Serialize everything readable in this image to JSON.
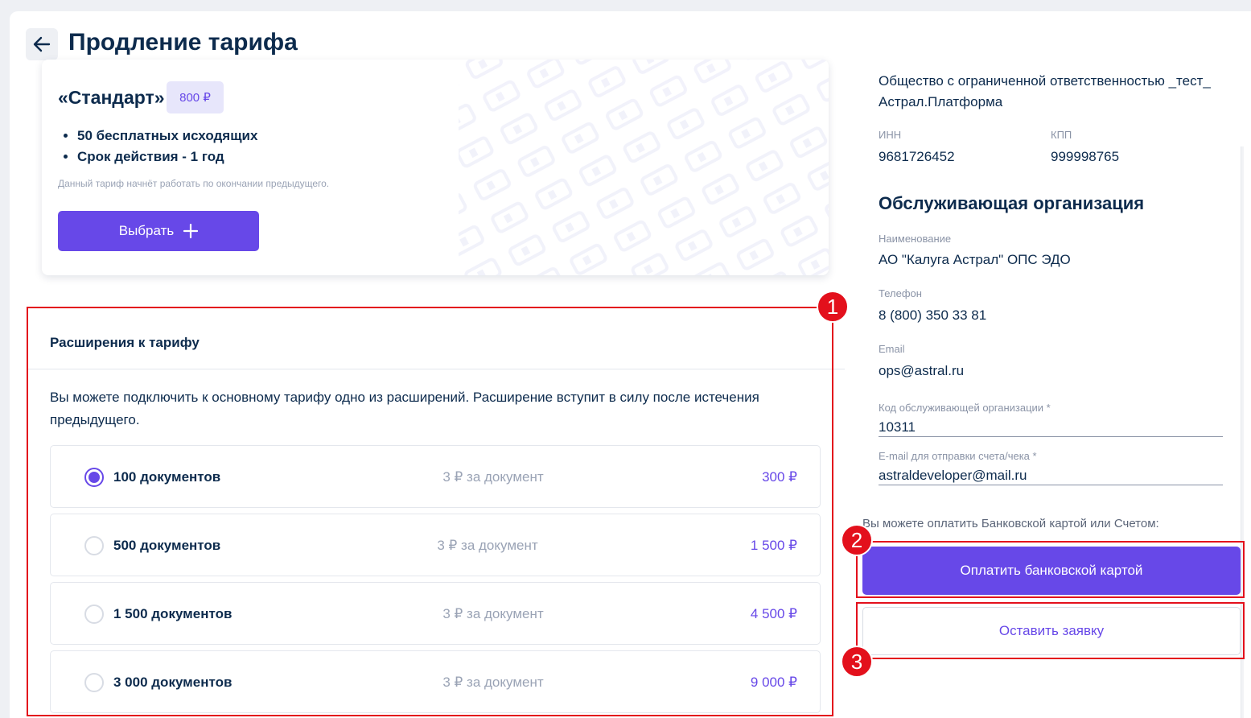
{
  "header": {
    "title": "Продление тарифа"
  },
  "tariff": {
    "name": "«Стандарт»",
    "price": "800 ₽",
    "features": [
      "50 бесплатных исходящих",
      "Срок действия - 1 год"
    ],
    "note": "Данный тариф начнёт работать по окончании предыдущего.",
    "choose_label": "Выбрать"
  },
  "extensions": {
    "title": "Расширения к тарифу",
    "description": "Вы можете подключить к основному тарифу одно из расширений. Расширение вступит в силу после истечения предыдущего.",
    "options": [
      {
        "name": "100 документов",
        "unit": "3 ₽ за документ",
        "price": "300 ₽",
        "selected": true
      },
      {
        "name": "500 документов",
        "unit": "3 ₽ за документ",
        "price": "1 500 ₽",
        "selected": false
      },
      {
        "name": "1 500 документов",
        "unit": "3 ₽ за документ",
        "price": "4 500 ₽",
        "selected": false
      },
      {
        "name": "3 000 документов",
        "unit": "3 ₽ за документ",
        "price": "9 000 ₽",
        "selected": false
      }
    ]
  },
  "organization": {
    "name": "Общество с ограниченной ответственностью _тест_ Астрал.Платформа",
    "inn_label": "ИНН",
    "inn": "9681726452",
    "kpp_label": "КПП",
    "kpp": "999998765"
  },
  "service_org": {
    "heading": "Обслуживающая организация",
    "name_label": "Наименование",
    "name": "АО \"Калуга Астрал\" ОПС ЭДО",
    "phone_label": "Телефон",
    "phone": "8 (800) 350 33 81",
    "email_label": "Email",
    "email": "ops@astral.ru",
    "code_label": "Код обслуживающей организации *",
    "code_value": "10311",
    "invoice_email_label": "E-mail для отправки счета/чека *",
    "invoice_email_value": "astraldeveloper@mail.ru"
  },
  "payment": {
    "note": "Вы можете оплатить Банковской картой или Счетом:",
    "card_label": "Оплатить банковской картой",
    "request_label": "Оставить заявку"
  },
  "annotations": [
    "1",
    "2",
    "3"
  ],
  "colors": {
    "accent": "#6748e8",
    "annotation": "#e3101c",
    "text": "#0d2b4d"
  }
}
